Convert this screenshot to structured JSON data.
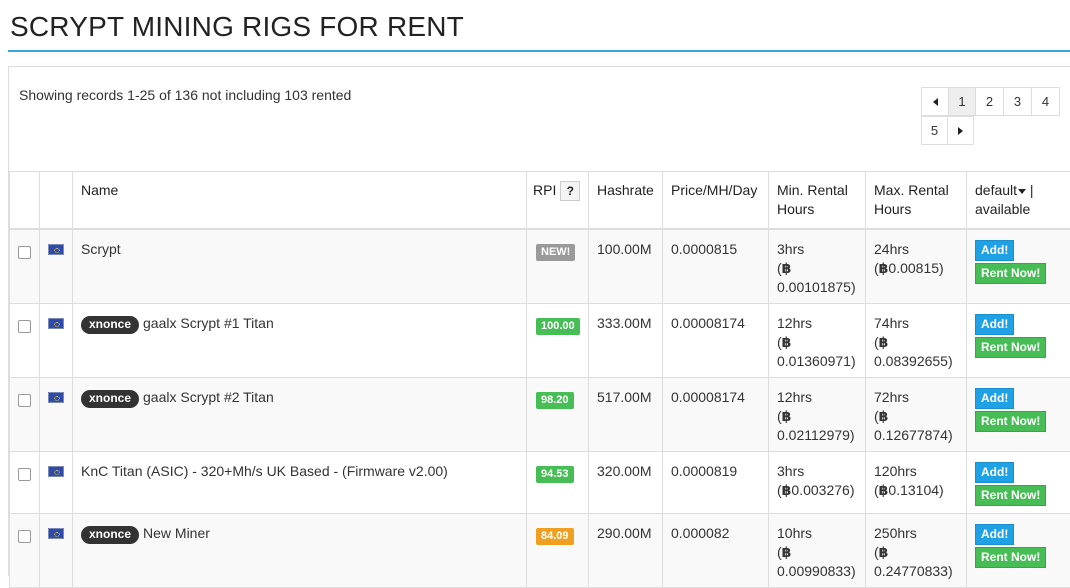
{
  "page": {
    "title": "SCRYPT MINING RIGS FOR RENT"
  },
  "records_text": "Showing records 1-25 of 136 not including 103 rented",
  "pagination": {
    "pages": [
      "1",
      "2",
      "3",
      "4",
      "5"
    ],
    "active": "1"
  },
  "table": {
    "headers": {
      "name": "Name",
      "rpi": "RPI",
      "rpi_help": "?",
      "hashrate": "Hashrate",
      "price": "Price/MH/Day",
      "min_rental_1": "Min. Rental",
      "min_rental_2": "Hours",
      "max_rental_1": "Max. Rental",
      "max_rental_2": "Hours",
      "sort_1": "default",
      "sort_1b": " |",
      "sort_2": "available"
    },
    "rows": [
      {
        "tag": "",
        "name": "Scrypt",
        "rpi": "NEW!",
        "rpi_color": "#9a9a9a",
        "hashrate": "100.00M",
        "price": "0.0000815",
        "min_hours": "3hrs",
        "min_price_a": "(",
        "min_price_b": "",
        "min_price_c": "0.00101875)",
        "max_hours": "24hrs",
        "max_price_a": "(",
        "max_price_b": "0.00815)",
        "max_price_c": ""
      },
      {
        "tag": "xnonce",
        "name": "gaalx Scrypt #1 Titan",
        "rpi": "100.00",
        "rpi_color": "#47bd55",
        "hashrate": "333.00M",
        "price": "0.00008174",
        "min_hours": "12hrs",
        "min_price_a": "(",
        "min_price_b": "",
        "min_price_c": "0.01360971)",
        "max_hours": "74hrs",
        "max_price_a": "(",
        "max_price_b": "",
        "max_price_c": "0.08392655)"
      },
      {
        "tag": "xnonce",
        "name": "gaalx Scrypt #2 Titan",
        "rpi": "98.20",
        "rpi_color": "#47bd55",
        "hashrate": "517.00M",
        "price": "0.00008174",
        "min_hours": "12hrs",
        "min_price_a": "(",
        "min_price_b": "",
        "min_price_c": "0.02112979)",
        "max_hours": "72hrs",
        "max_price_a": "(",
        "max_price_b": "",
        "max_price_c": "0.12677874)"
      },
      {
        "tag": "",
        "name": "KnC Titan (ASIC) - 320+Mh/s UK Based - (Firmware v2.00)",
        "rpi": "94.53",
        "rpi_color": "#47bd55",
        "hashrate": "320.00M",
        "price": "0.0000819",
        "min_hours": "3hrs",
        "min_price_a": "(",
        "min_price_b": "0.003276)",
        "min_price_c": "",
        "max_hours": "120hrs",
        "max_price_a": "(",
        "max_price_b": "0.13104)",
        "max_price_c": ""
      },
      {
        "tag": "xnonce",
        "name": "New Miner",
        "rpi": "84.09",
        "rpi_color": "#f0a020",
        "hashrate": "290.00M",
        "price": "0.000082",
        "min_hours": "10hrs",
        "min_price_a": "(",
        "min_price_b": "",
        "min_price_c": "0.00990833)",
        "max_hours": "250hrs",
        "max_price_a": "(",
        "max_price_b": "",
        "max_price_c": "0.24770833)"
      }
    ],
    "buttons": {
      "add": "Add!",
      "rent": "Rent Now!"
    },
    "btc_symbol": "฿"
  },
  "icons": {
    "flag": "eu-flag-icon",
    "prev": "caret-left-icon",
    "next": "caret-right-icon",
    "sort": "caret-down-icon"
  },
  "colors": {
    "accent": "#3aa6d8",
    "add": "#1fa1e6",
    "rent": "#47bd55"
  }
}
